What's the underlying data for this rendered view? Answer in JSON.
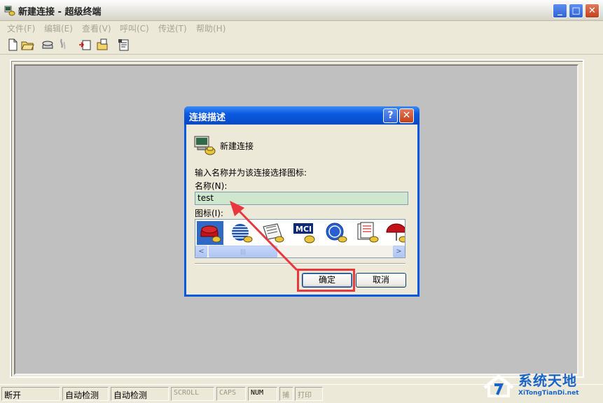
{
  "window": {
    "title": "新建连接 - 超级终端",
    "minimize_glyph": "_",
    "maximize_glyph": "□",
    "close_glyph": "✕"
  },
  "menu": [
    {
      "label": "文件(F)"
    },
    {
      "label": "编辑(E)"
    },
    {
      "label": "查看(V)"
    },
    {
      "label": "呼叫(C)"
    },
    {
      "label": "传送(T)"
    },
    {
      "label": "帮助(H)"
    }
  ],
  "toolbar": {
    "icons": [
      "new-icon",
      "open-icon",
      "dial-icon",
      "disconnect-icon",
      "send-icon",
      "receive-icon",
      "properties-icon"
    ]
  },
  "dialog": {
    "title": "连接描述",
    "help_glyph": "?",
    "close_glyph": "✕",
    "connection_label": "新建连接",
    "instruction": "输入名称并为该连接选择图标:",
    "name_label": "名称(N):",
    "name_value": "test",
    "icon_label": "图标(I):",
    "icon_badge_mci": "MCI",
    "icons": [
      "phone-icon",
      "globe-icon",
      "newspaper-icon",
      "mci-icon",
      "ge-icon",
      "docs-icon",
      "umbrella-icon"
    ],
    "scroll_left": "<",
    "scroll_right": ">",
    "scroll_thumb": "|||",
    "ok_label": "确定",
    "cancel_label": "取消"
  },
  "status": [
    {
      "text": "断开",
      "dim": false
    },
    {
      "text": "自动检测",
      "dim": false
    },
    {
      "text": "自动检测",
      "dim": false
    },
    {
      "text": "SCROLL",
      "dim": true
    },
    {
      "text": "CAPS",
      "dim": true
    },
    {
      "text": "NUM",
      "dim": false
    },
    {
      "text": "捕",
      "dim": true
    },
    {
      "text": "打印",
      "dim": true
    }
  ],
  "watermark": {
    "brand": "系统天地",
    "url": "XiTongTianDi.net"
  },
  "colors": {
    "annotation": "#e8383d",
    "xp_blue": "#0a58e0",
    "terminal_bg": "#c0c0c0"
  }
}
